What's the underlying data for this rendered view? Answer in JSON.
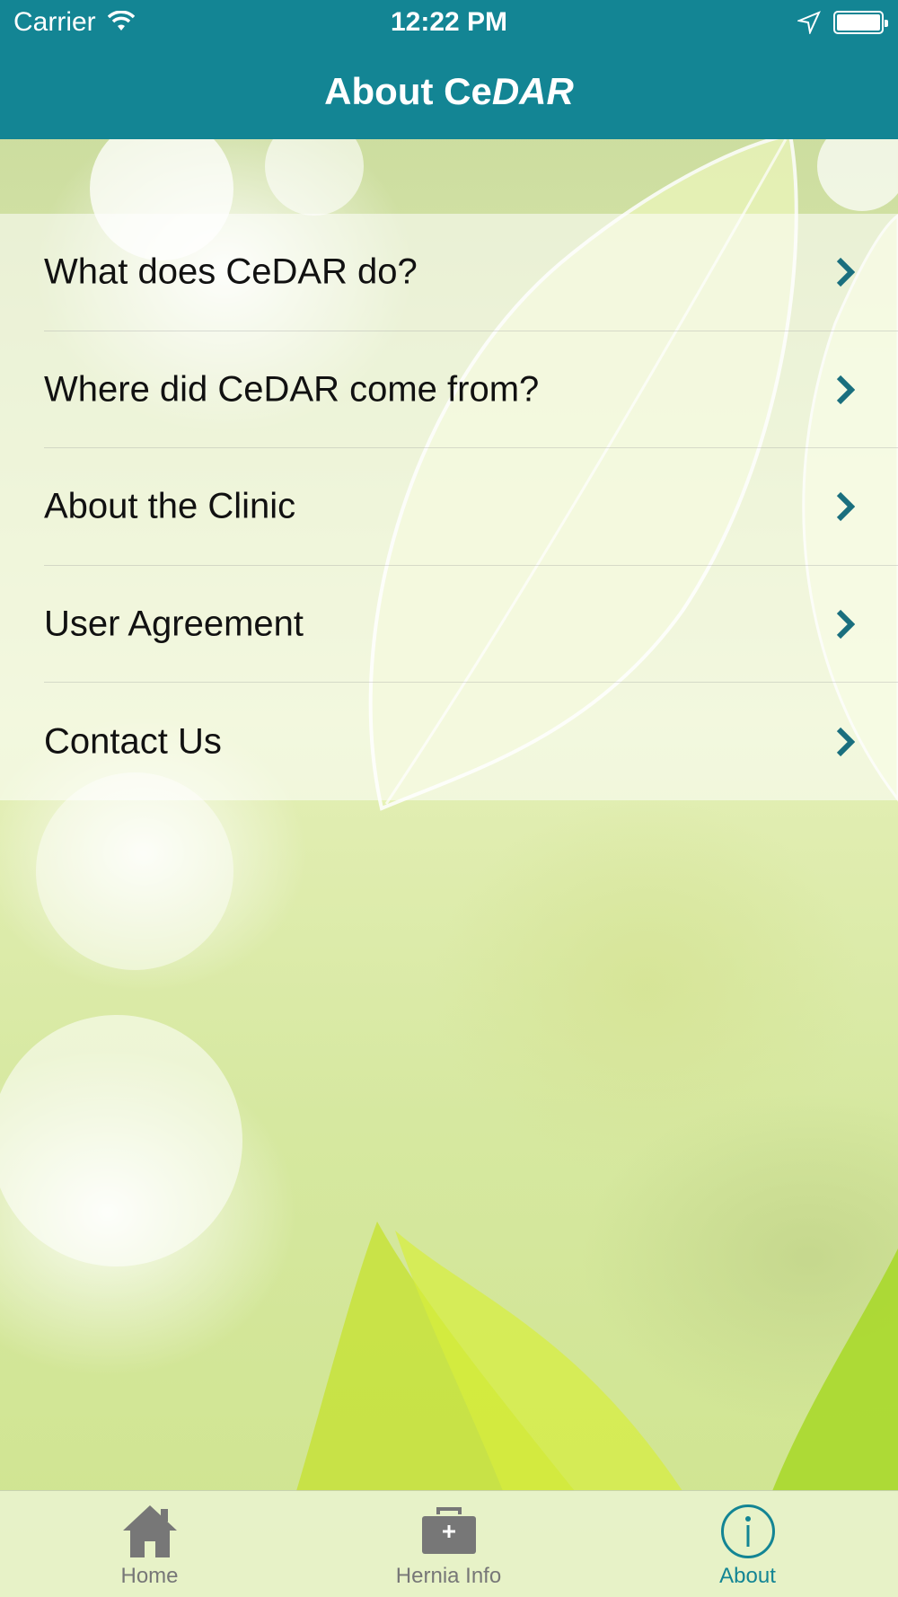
{
  "status_bar": {
    "carrier": "Carrier",
    "time": "12:22 PM",
    "wifi_icon": "wifi-icon",
    "location_icon": "location-arrow-icon",
    "battery_icon": "battery-icon"
  },
  "nav": {
    "title_prefix": "About Ce",
    "title_suffix": "DAR"
  },
  "menu": {
    "items": [
      {
        "label": "What does CeDAR do?",
        "icon": "chevron-right-icon"
      },
      {
        "label": "Where did CeDAR come from?",
        "icon": "chevron-right-icon"
      },
      {
        "label": "About the Clinic",
        "icon": "chevron-right-icon"
      },
      {
        "label": "User Agreement",
        "icon": "chevron-right-icon"
      },
      {
        "label": "Contact Us",
        "icon": "chevron-right-icon"
      }
    ]
  },
  "tabbar": {
    "tabs": [
      {
        "label": "Home",
        "icon": "home-icon",
        "active": false
      },
      {
        "label": "Hernia Info",
        "icon": "medical-kit-icon",
        "active": false
      },
      {
        "label": "About",
        "icon": "info-circle-icon",
        "active": true
      }
    ]
  },
  "colors": {
    "accent": "#138594",
    "chevron": "#1a6f7e",
    "tab_inactive": "#777777"
  }
}
